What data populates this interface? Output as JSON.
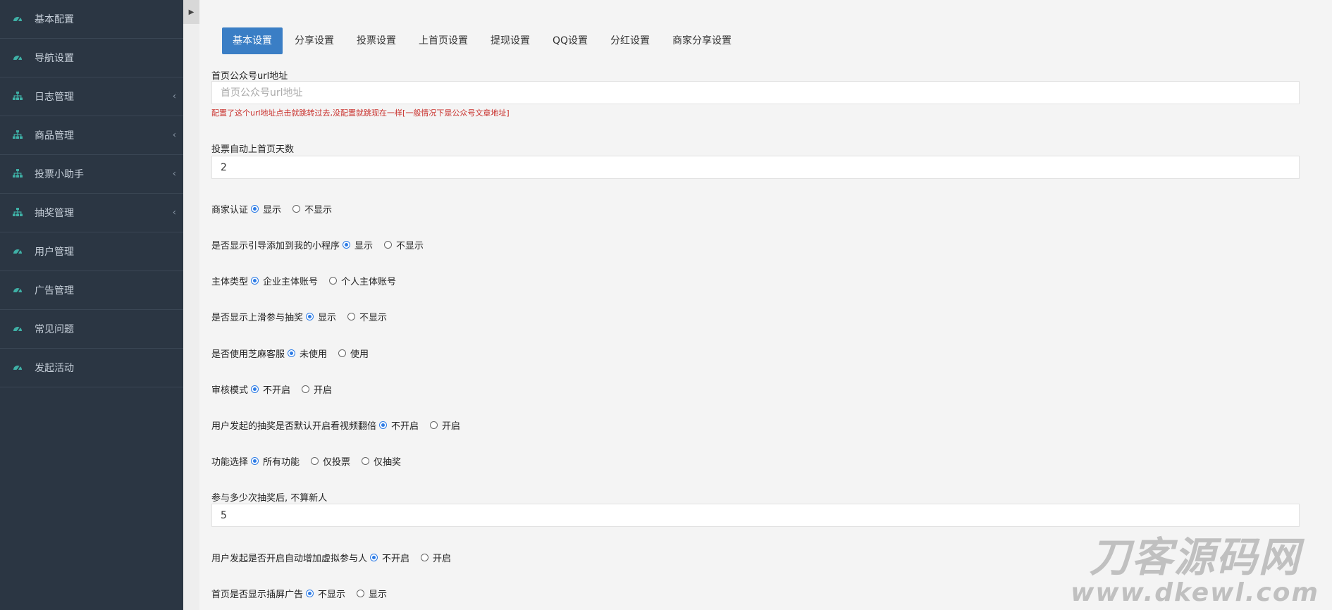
{
  "sidebar": {
    "items": [
      {
        "label": "基本配置",
        "icon": "dashboard-icon",
        "expandable": false
      },
      {
        "label": "导航设置",
        "icon": "dashboard-icon",
        "expandable": false
      },
      {
        "label": "日志管理",
        "icon": "sitemap-icon",
        "expandable": true
      },
      {
        "label": "商品管理",
        "icon": "sitemap-icon",
        "expandable": true
      },
      {
        "label": "投票小助手",
        "icon": "sitemap-icon",
        "expandable": true
      },
      {
        "label": "抽奖管理",
        "icon": "sitemap-icon",
        "expandable": true
      },
      {
        "label": "用户管理",
        "icon": "dashboard-icon",
        "expandable": false
      },
      {
        "label": "广告管理",
        "icon": "dashboard-icon",
        "expandable": false
      },
      {
        "label": "常见问题",
        "icon": "dashboard-icon",
        "expandable": false
      },
      {
        "label": "发起活动",
        "icon": "dashboard-icon",
        "expandable": false
      }
    ],
    "arrow_glyph": "‹"
  },
  "toggle_glyph": "▶",
  "tabs": [
    {
      "label": "基本设置",
      "active": true
    },
    {
      "label": "分享设置",
      "active": false
    },
    {
      "label": "投票设置",
      "active": false
    },
    {
      "label": "上首页设置",
      "active": false
    },
    {
      "label": "提现设置",
      "active": false
    },
    {
      "label": "QQ设置",
      "active": false
    },
    {
      "label": "分红设置",
      "active": false
    },
    {
      "label": "商家分享设置",
      "active": false
    }
  ],
  "form": {
    "url_field": {
      "label": "首页公众号url地址",
      "placeholder": "首页公众号url地址",
      "value": "",
      "hint": "配置了这个url地址点击就跳转过去,没配置就跳现在一样[一般情况下是公众号文章地址]"
    },
    "vote_days": {
      "label": "投票自动上首页天数",
      "value": "2"
    },
    "merchant_cert": {
      "label": "商家认证",
      "options": [
        "显示",
        "不显示"
      ],
      "selected": 0
    },
    "guide_add": {
      "label": "是否显示引导添加到我的小程序",
      "options": [
        "显示",
        "不显示"
      ],
      "selected": 0
    },
    "entity_type": {
      "label": "主体类型",
      "options": [
        "企业主体账号",
        "个人主体账号"
      ],
      "selected": 0
    },
    "swipe_lottery": {
      "label": "是否显示上滑参与抽奖",
      "options": [
        "显示",
        "不显示"
      ],
      "selected": 0
    },
    "sesame_service": {
      "label": "是否使用芝麻客服",
      "options": [
        "未使用",
        "使用"
      ],
      "selected": 0
    },
    "review_mode": {
      "label": "审核模式",
      "options": [
        "不开启",
        "开启"
      ],
      "selected": 0
    },
    "video_double": {
      "label": "用户发起的抽奖是否默认开启看视频翻倍",
      "options": [
        "不开启",
        "开启"
      ],
      "selected": 0
    },
    "feature_select": {
      "label": "功能选择",
      "options": [
        "所有功能",
        "仅投票",
        "仅抽奖"
      ],
      "selected": 0
    },
    "lottery_count": {
      "label": "参与多少次抽奖后, 不算新人",
      "value": "5"
    },
    "virtual_join": {
      "label": "用户发起是否开启自动增加虚拟参与人",
      "options": [
        "不开启",
        "开启"
      ],
      "selected": 0
    },
    "popup_ad": {
      "label": "首页是否显示插屏广告",
      "options": [
        "不显示",
        "显示"
      ],
      "selected": 0
    }
  },
  "watermark": {
    "line1": "刀客源码网",
    "line2": "www.dkewl.com"
  },
  "colors": {
    "sidebar_bg": "#2b3643",
    "accent": "#3a7ec5",
    "icon": "#3fb0a6",
    "hint": "#c9302c"
  }
}
